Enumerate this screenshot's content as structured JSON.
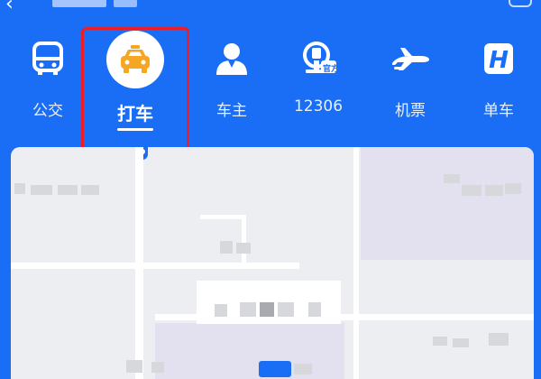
{
  "header": {
    "back_icon": "chevron-left-icon"
  },
  "tabs": [
    {
      "label": "公交",
      "icon": "bus-icon",
      "active": false
    },
    {
      "label": "打车",
      "icon": "taxi-icon",
      "active": true
    },
    {
      "label": "车主",
      "icon": "driver-icon",
      "active": false
    },
    {
      "label": "12306",
      "icon": "railway-icon",
      "active": false
    },
    {
      "label": "机票",
      "icon": "airplane-icon",
      "active": false
    },
    {
      "label": "单车",
      "icon": "bike-icon",
      "active": false
    }
  ],
  "railway_icon_text": "官方",
  "colors": {
    "primary_blue": "#1a6ef5",
    "taxi_orange": "#f5a623",
    "highlight_red": "#e81e2a"
  }
}
